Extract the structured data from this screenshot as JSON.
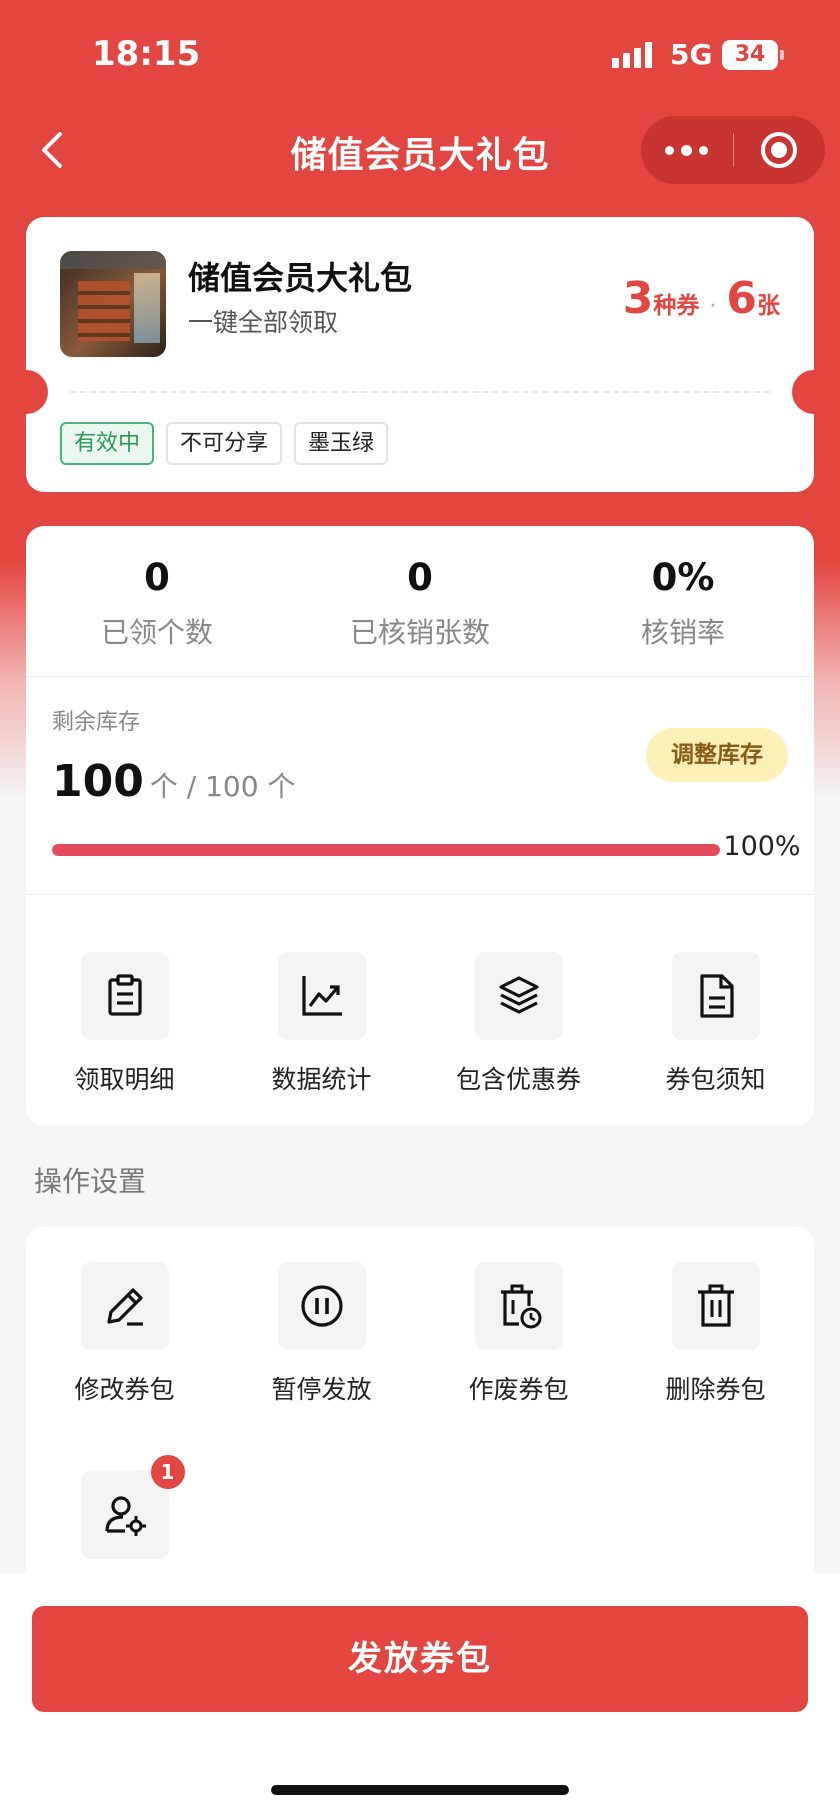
{
  "status": {
    "time": "18:15",
    "network": "5G",
    "battery": "34"
  },
  "nav": {
    "title": "储值会员大礼包"
  },
  "package": {
    "name": "储值会员大礼包",
    "subtitle": "一键全部领取",
    "coupon_types": "3",
    "coupon_types_unit": "种券",
    "separator": "·",
    "coupon_count": "6",
    "coupon_count_unit": "张",
    "tags": [
      "有效中",
      "不可分享",
      "墨玉绿"
    ]
  },
  "stats": [
    {
      "value": "0",
      "label": "已领个数"
    },
    {
      "value": "0",
      "label": "已核销张数"
    },
    {
      "value": "0%",
      "label": "核销率"
    }
  ],
  "stock": {
    "label": "剩余库存",
    "remaining": "100",
    "unit_total": "个 / 100 个",
    "adjust_label": "调整库存",
    "percent": "100%",
    "fraction": 1.0
  },
  "quick_actions": [
    {
      "label": "领取明细",
      "icon": "clipboard-icon"
    },
    {
      "label": "数据统计",
      "icon": "chart-icon"
    },
    {
      "label": "包含优惠券",
      "icon": "layers-icon"
    },
    {
      "label": "券包须知",
      "icon": "document-icon"
    }
  ],
  "settings": {
    "title": "操作设置",
    "items": [
      {
        "label": "修改券包",
        "icon": "edit-icon"
      },
      {
        "label": "暂停发放",
        "icon": "pause-icon"
      },
      {
        "label": "作废券包",
        "icon": "void-icon"
      },
      {
        "label": "删除券包",
        "icon": "trash-icon"
      },
      {
        "label": "",
        "icon": "user-settings-icon",
        "badge": "1"
      }
    ]
  },
  "primary_button": {
    "label": "发放券包"
  },
  "colors": {
    "brand": "#e34540",
    "active_tag": "#2c9a58",
    "progress": "#e34a5a",
    "adjust_bg": "#fdefb8"
  }
}
